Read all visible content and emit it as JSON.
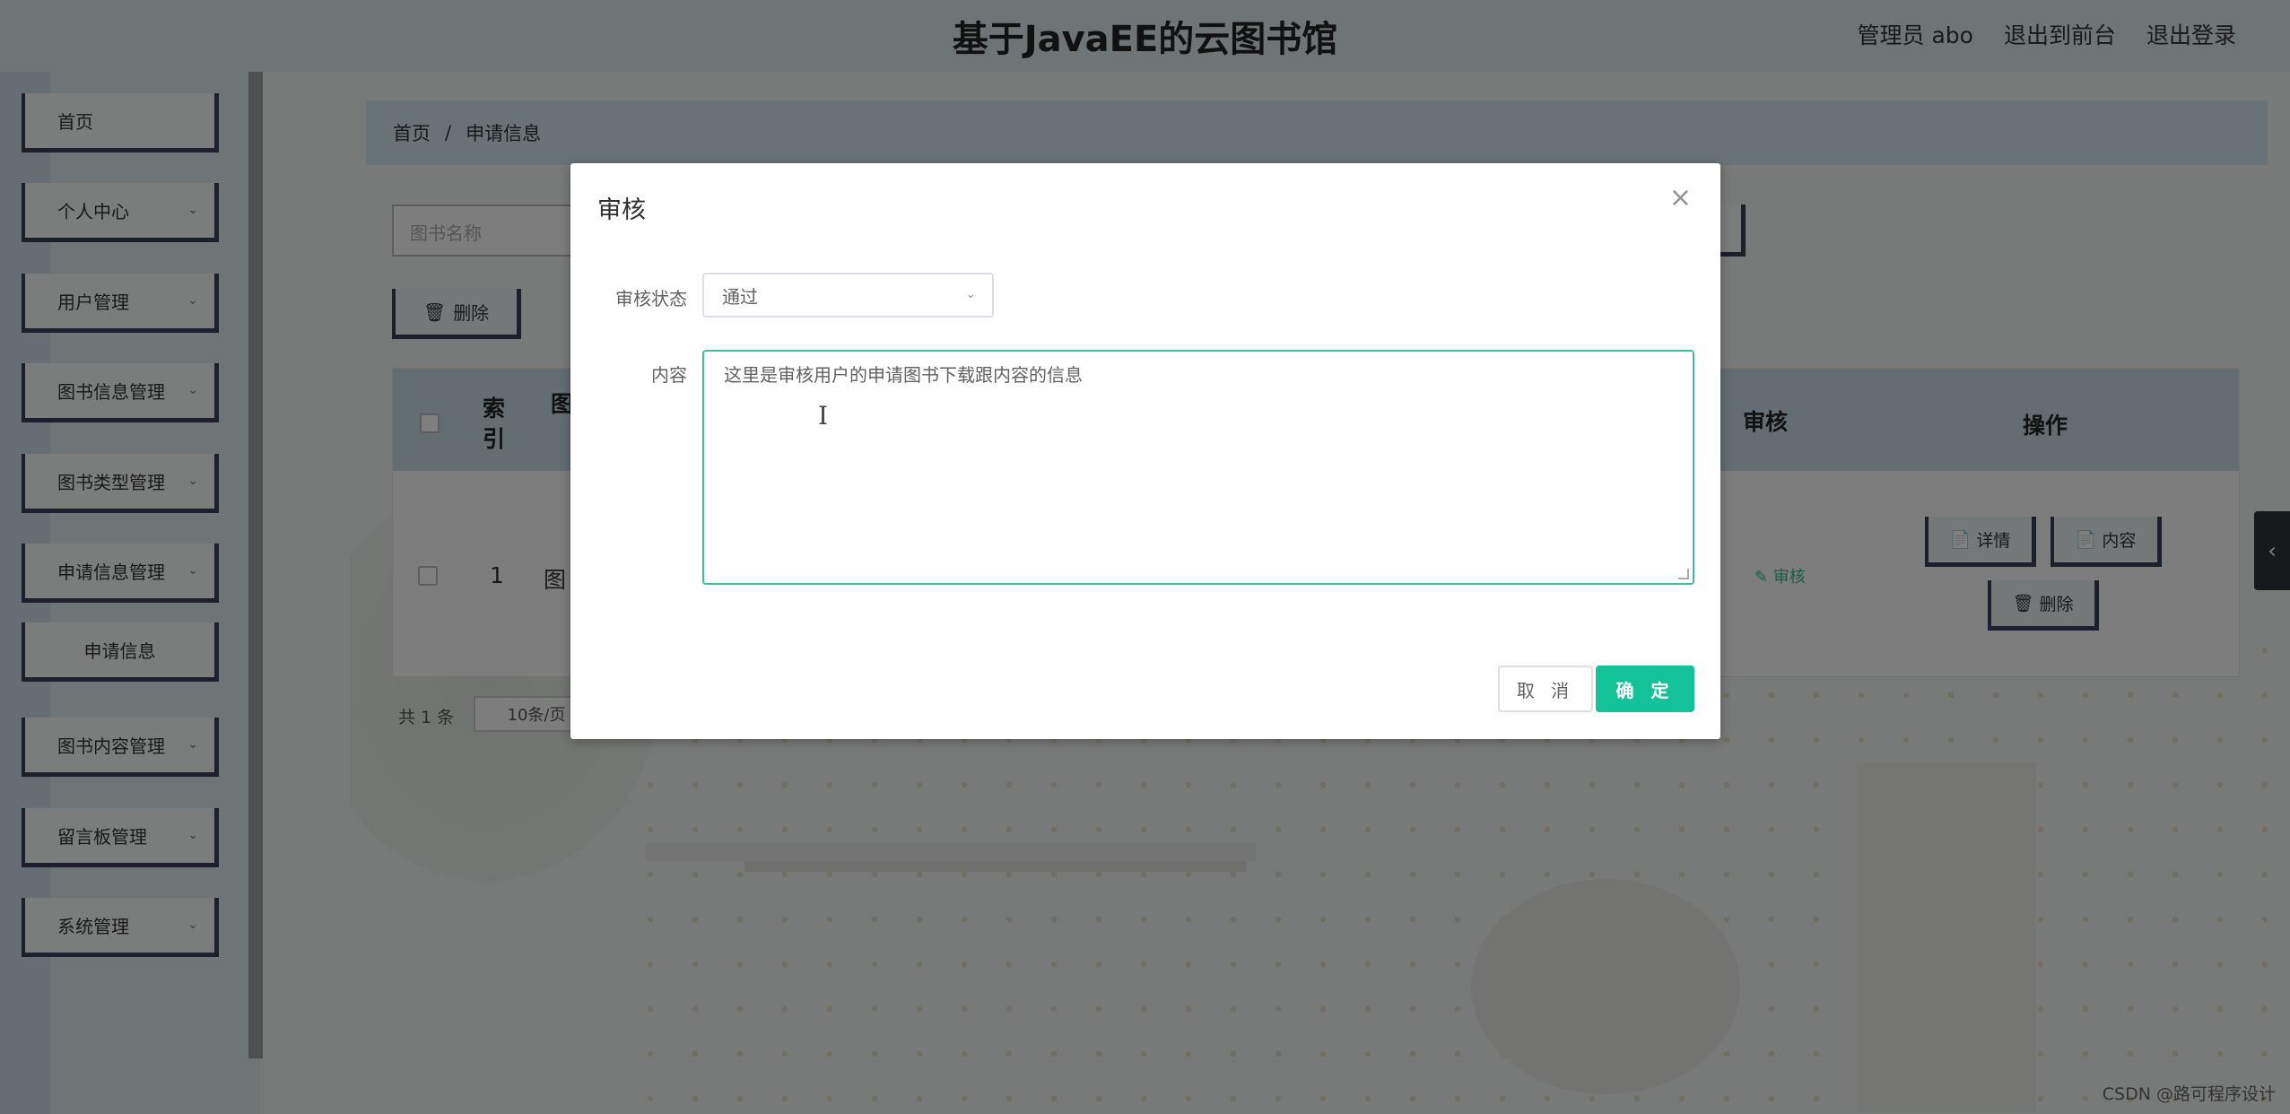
{
  "header": {
    "title": "基于JavaEE的云图书馆",
    "user_label": "管理员 abo",
    "frontend_link": "退出到前台",
    "logout_link": "退出登录"
  },
  "sidebar": {
    "items": [
      {
        "label": "首页"
      },
      {
        "label": "个人中心"
      },
      {
        "label": "用户管理"
      },
      {
        "label": "图书信息管理"
      },
      {
        "label": "图书类型管理"
      },
      {
        "label": "申请信息管理"
      },
      {
        "label": "申请信息"
      },
      {
        "label": "图书内容管理"
      },
      {
        "label": "留言板管理"
      },
      {
        "label": "系统管理"
      }
    ]
  },
  "breadcrumb": {
    "home": "首页",
    "separator": "/",
    "current": "申请信息"
  },
  "toolbar": {
    "search_placeholder": "图书名称",
    "delete_label": "删除"
  },
  "table": {
    "headers": {
      "index": "索引",
      "name_partial": "图",
      "audit": "审核",
      "actions": "操作"
    },
    "rows": [
      {
        "index": "1",
        "name_partial": "图",
        "audit_link": "审核",
        "detail_btn": "详情",
        "content_btn": "内容",
        "delete_btn": "删除"
      }
    ]
  },
  "pager": {
    "total": "共 1 条",
    "page_size": "10条/页"
  },
  "dialog": {
    "title": "审核",
    "status_label": "审核状态",
    "status_value": "通过",
    "content_label": "内容",
    "content_value": "这里是审核用户的申请图书下载跟内容的信息",
    "cancel_label": "取 消",
    "confirm_label": "确 定"
  },
  "watermark": "CSDN @路可程序设计"
}
